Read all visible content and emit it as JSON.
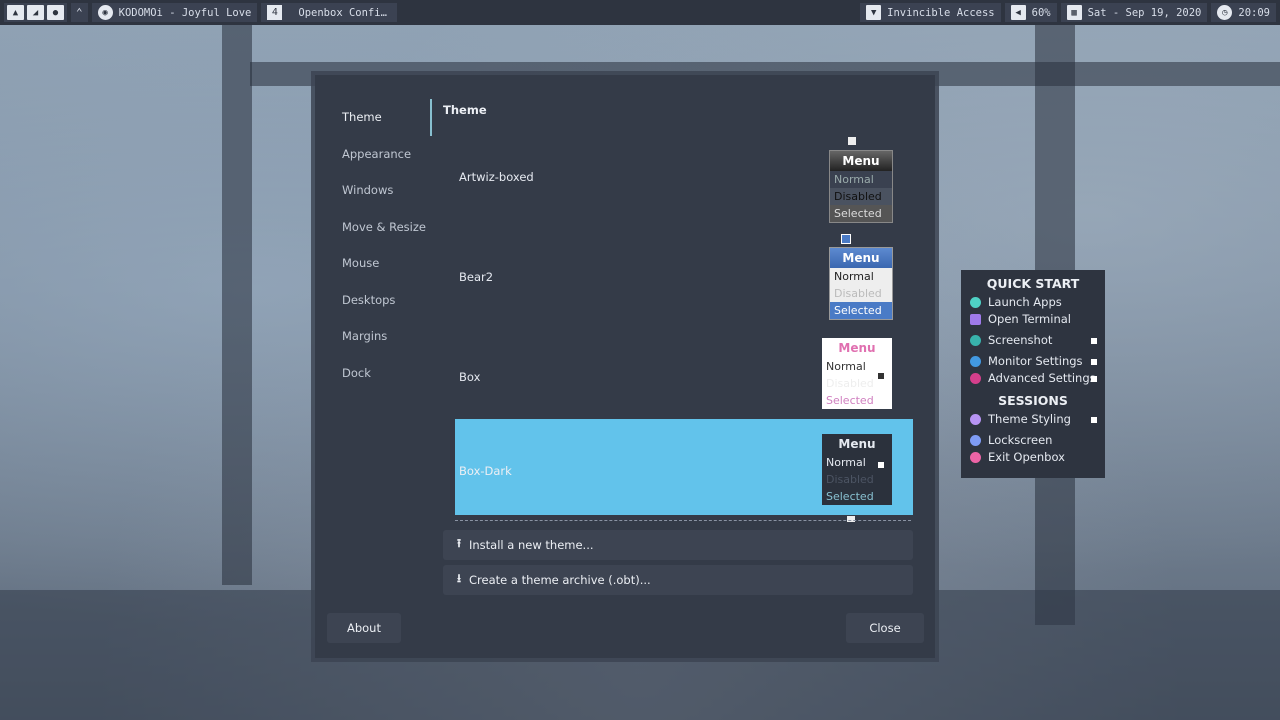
{
  "panel": {
    "window_title": "KODOMOi - Joyful Love",
    "workspace_number": "4",
    "active_app": "Openbox Confi…",
    "network": "Invincible Access",
    "volume": "60%",
    "date": "Sat - Sep 19, 2020",
    "time": "20:09"
  },
  "sidebar": {
    "items": [
      {
        "label": "Theme"
      },
      {
        "label": "Appearance"
      },
      {
        "label": "Windows"
      },
      {
        "label": "Move & Resize"
      },
      {
        "label": "Mouse"
      },
      {
        "label": "Desktops"
      },
      {
        "label": "Margins"
      },
      {
        "label": "Dock"
      }
    ]
  },
  "main": {
    "header": "Theme",
    "themes": [
      {
        "name": "Artwiz-boxed"
      },
      {
        "name": "Bear2"
      },
      {
        "name": "Box"
      },
      {
        "name": "Box-Dark"
      }
    ],
    "preview": {
      "menu": "Menu",
      "normal": "Normal",
      "disabled": "Disabled",
      "selected": "Selected"
    },
    "install_button": "Install a new theme...",
    "archive_button": "Create a theme archive (.obt)...",
    "about_button": "About",
    "close_button": "Close"
  },
  "quickstart": {
    "title": "QUICK START",
    "items": [
      {
        "label": "Launch Apps"
      },
      {
        "label": "Open Terminal"
      },
      {
        "label": "Screenshot"
      },
      {
        "label": "Monitor Settings"
      },
      {
        "label": "Advanced Settings"
      }
    ],
    "sessions_title": "SESSIONS",
    "sessions": [
      {
        "label": "Theme Styling"
      },
      {
        "label": "Lockscreen"
      },
      {
        "label": "Exit Openbox"
      }
    ]
  },
  "colors": {
    "accent": "#62c3eb",
    "panel_bg": "#2e3440",
    "window_bg": "#343b48"
  }
}
